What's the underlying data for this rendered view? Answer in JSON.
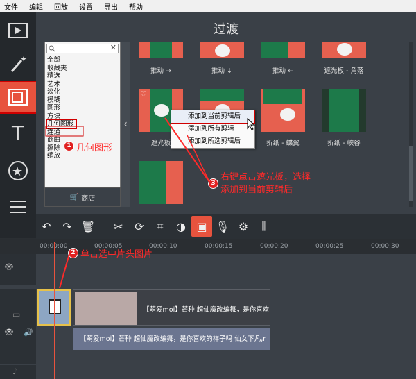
{
  "menu": [
    "文件",
    "编辑",
    "回放",
    "设置",
    "导出",
    "帮助"
  ],
  "panel": {
    "title": "过渡"
  },
  "categories": [
    "全部",
    "收藏夹",
    "精选",
    "艺术",
    "淡化",
    "模糊",
    "圆形",
    "方块",
    "几何图形",
    "连通",
    "商曲",
    "擦除",
    "缩放"
  ],
  "selected_category": "几何图形",
  "store_label": "商店",
  "transitions_row1": [
    "推动 →",
    "推动 ↓",
    "推动 ←",
    "遮光板 - 角落"
  ],
  "transitions_row2": [
    "遮光板",
    "",
    "折纸 - 蝶翼",
    "折纸 - 峡谷"
  ],
  "context_menu": [
    "添加到当前剪辑后",
    "添加到所有剪辑",
    "添加到所选剪辑后"
  ],
  "ruler_ticks": [
    "00:00:00",
    "00:00:05",
    "00:00:10",
    "00:00:15",
    "00:00:20",
    "00:00:25",
    "00:00:30"
  ],
  "video_clip_title": "【萌爱moi】芒种 超仙魔改编舞，是你喜欢",
  "audio_clip_title": "【萌爱moi】芒种 超仙魔改编舞，是你喜欢的样子吗 仙女下凡,r",
  "annotations": {
    "a1_num": "1",
    "a1_text": "几何图形",
    "a2_num": "2",
    "a2_text": "单击选中片头图片",
    "a3_num": "3",
    "a3_text_line1": "右键点击遮光板，选择",
    "a3_text_line2": "添加到当前剪辑后"
  },
  "colors": {
    "accent": "#e7533e",
    "annotation": "#ff2a2a"
  }
}
